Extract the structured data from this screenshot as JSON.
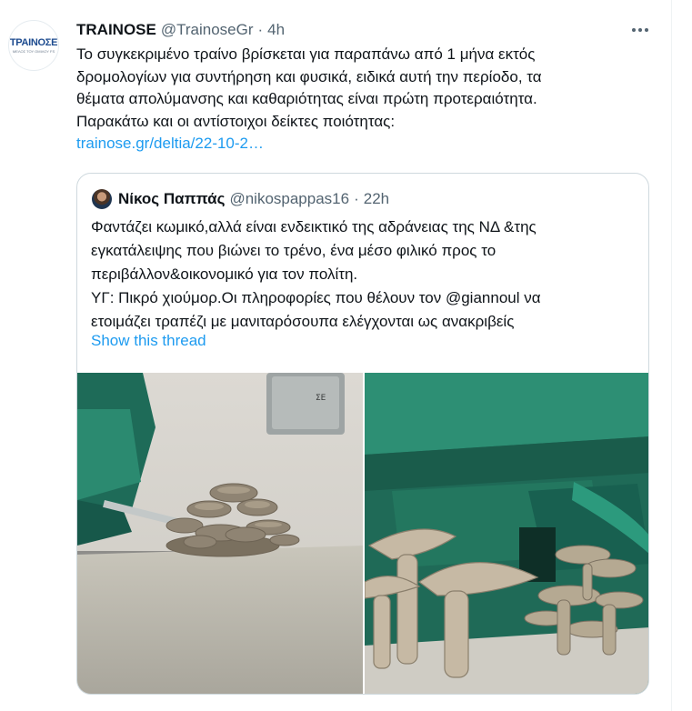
{
  "tweet": {
    "author_name": "TRAINOSE",
    "author_handle": "@TrainoseGr",
    "separator": "·",
    "time": "4h",
    "avatar_logo_text": "TPAINOΣE",
    "avatar_logo_subtext": "ΜΕΛΟΣ ΤΟΥ ΟΜΙΛΟΥ FS",
    "text_lines": [
      "Το συγκεκριμένο τραίνο βρίσκεται για παραπάνω από 1 μήνα εκτός",
      "δρομολογίων για συντήρηση και φυσικά, ειδικά αυτή την περίοδο, τα",
      "θέματα απολύμανσης και καθαριότητας είναι πρώτη προτεραιότητα.",
      "Παρακάτω και οι αντίστοιχοι δείκτες ποιότητας:"
    ],
    "link_text": "trainose.gr/deltia/22-10-2…"
  },
  "quoted": {
    "author_name": "Νίκος Παππάς",
    "author_handle": "@nikospappas16",
    "separator": "·",
    "time": "22h",
    "text_lines": [
      "Φαντάζει κωμικό,αλλά είναι ενδεικτικό της αδράνειας της ΝΔ &της",
      "εγκατάλειψης που βιώνει το τρένο, ένα μέσο φιλικό προς το",
      "περιβάλλον&οικονομικό για τον πολίτη.",
      "ΥΓ: Πικρό χιούμορ.Οι πληροφορίες που θέλουν τον @giannoul να",
      "ετοιμάζει τραπέζι με μανιταρόσουπα ελέγχονται ως ανακριβείς"
    ],
    "show_thread_label": "Show this thread",
    "media_sign_text": "ΣΕ"
  },
  "icons": {
    "more": "more-horizontal-icon"
  },
  "colors": {
    "link": "#1d9bf0",
    "secondary_text": "#536471",
    "border": "#cfd9de"
  }
}
